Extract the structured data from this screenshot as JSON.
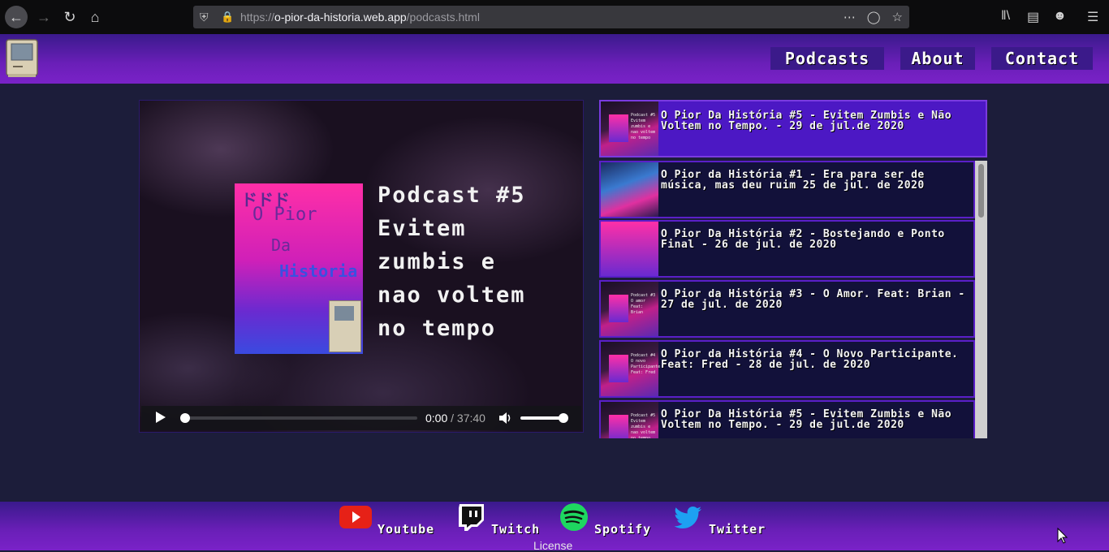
{
  "browser": {
    "url_prefix": "https://",
    "url_domain": "o-pior-da-historia.web.app",
    "url_path": "/podcasts.html"
  },
  "nav": {
    "links": [
      "Podcasts",
      "About",
      "Contact"
    ]
  },
  "player": {
    "cover_title_lines": [
      "Podcast #5",
      "Evitem",
      "zumbis e",
      "nao voltem",
      "no tempo"
    ],
    "cover_art_text": [
      "ドドド",
      "O Pior",
      "Da",
      "Historia"
    ],
    "current_time": "0:00",
    "separator": "/",
    "duration": "37:40"
  },
  "playlist": {
    "now_playing": "O Pior Da História #5 - Evitem Zumbis e Não Voltem no Tempo. - 29 de jul.de 2020",
    "items": [
      "O Pior da História #1 - Era para ser de música, mas deu ruim 25 de jul. de 2020",
      "O Pior Da História #2 - Bostejando e Ponto Final - 26 de jul. de 2020",
      "O Pior da História #3 - O Amor. Feat: Brian - 27 de jul. de 2020",
      "O Pior da História #4 - O Novo Participante. Feat: Fred - 28 de jul. de 2020",
      "O Pior Da História #5 - Evitem Zumbis e Não Voltem no Tempo. - 29 de jul.de 2020"
    ]
  },
  "footer": {
    "social": [
      "Youtube",
      "Twitch",
      "Spotify",
      "Twitter"
    ],
    "license": "License"
  },
  "colors": {
    "header_gradient_top": "#3a1a8c",
    "header_gradient_bottom": "#7a22c8",
    "page_bg": "#1c1d3a",
    "playlist_current": "#4c18c4",
    "playlist_item": "#12113a",
    "youtube": "#e62117",
    "spotify": "#1ed760",
    "twitter": "#1da1f2"
  }
}
